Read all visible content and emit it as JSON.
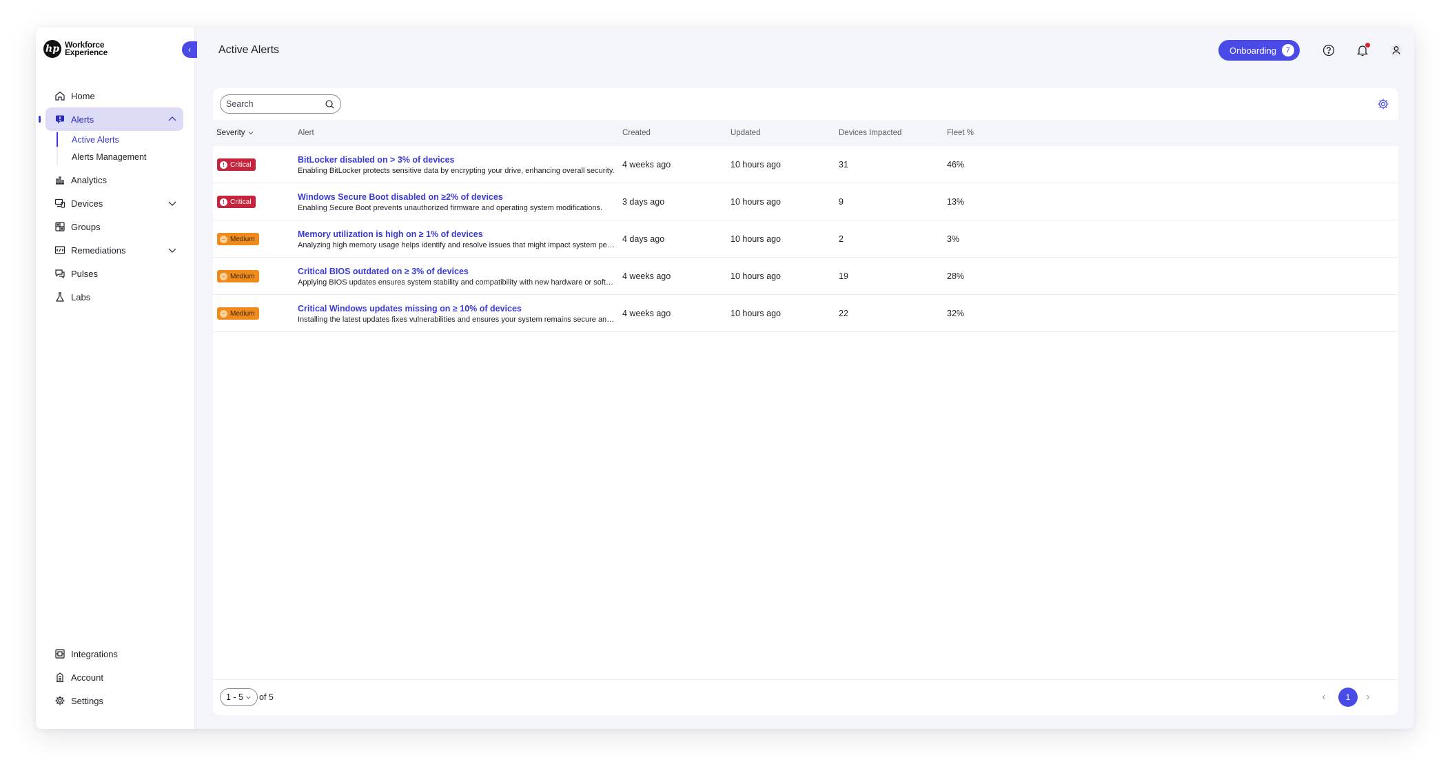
{
  "brand": {
    "logo_mark": "hp",
    "line1": "Workforce",
    "line2": "Experience"
  },
  "sidebar": {
    "items": [
      {
        "label": "Home",
        "icon": "home-icon"
      },
      {
        "label": "Alerts",
        "icon": "alert-icon"
      },
      {
        "label": "Analytics",
        "icon": "analytics-icon"
      },
      {
        "label": "Devices",
        "icon": "devices-icon"
      },
      {
        "label": "Groups",
        "icon": "groups-icon"
      },
      {
        "label": "Remediations",
        "icon": "remediations-icon"
      },
      {
        "label": "Pulses",
        "icon": "pulses-icon"
      },
      {
        "label": "Labs",
        "icon": "labs-icon"
      }
    ],
    "alerts_sub": [
      {
        "label": "Active Alerts"
      },
      {
        "label": "Alerts Management"
      }
    ],
    "bottom": [
      {
        "label": "Integrations",
        "icon": "integrations-icon"
      },
      {
        "label": "Account",
        "icon": "account-icon"
      },
      {
        "label": "Settings",
        "icon": "settings-icon"
      }
    ]
  },
  "header": {
    "title": "Active Alerts",
    "onboarding_label": "Onboarding",
    "onboarding_count": "7"
  },
  "search": {
    "placeholder": "Search"
  },
  "table": {
    "columns": {
      "severity": "Severity",
      "alert": "Alert",
      "created": "Created",
      "updated": "Updated",
      "devices": "Devices Impacted",
      "fleet": "Fleet %"
    },
    "rows": [
      {
        "severity": "Critical",
        "severity_glyph": "!",
        "title": "BitLocker disabled on > 3% of devices",
        "desc": "Enabling BitLocker protects sensitive data by encrypting your drive, enhancing overall security.",
        "created": "4 weeks ago",
        "updated": "10 hours ago",
        "devices": "31",
        "fleet": "46%"
      },
      {
        "severity": "Critical",
        "severity_glyph": "!",
        "title": "Windows Secure Boot disabled on ≥2% of devices",
        "desc": "Enabling Secure Boot prevents unauthorized firmware and operating system modifications.",
        "created": "3 days ago",
        "updated": "10 hours ago",
        "devices": "9",
        "fleet": "13%"
      },
      {
        "severity": "Medium",
        "severity_glyph": "−",
        "title": "Memory utilization is high on ≥ 1% of devices",
        "desc": "Analyzing high memory usage helps identify and resolve issues that might impact system performance.",
        "created": "4 days ago",
        "updated": "10 hours ago",
        "devices": "2",
        "fleet": "3%"
      },
      {
        "severity": "Medium",
        "severity_glyph": "−",
        "title": "Critical BIOS outdated on ≥ 3% of devices",
        "desc": "Applying BIOS updates ensures system stability and compatibility with new hardware or software.",
        "created": "4 weeks ago",
        "updated": "10 hours ago",
        "devices": "19",
        "fleet": "28%"
      },
      {
        "severity": "Medium",
        "severity_glyph": "−",
        "title": "Critical Windows updates missing on ≥ 10% of devices",
        "desc": "Installing the latest updates fixes vulnerabilities and ensures your system remains secure and stable.",
        "created": "4 weeks ago",
        "updated": "10 hours ago",
        "devices": "22",
        "fleet": "32%"
      }
    ]
  },
  "pagination": {
    "range": "1 - 5",
    "of_text": "of 5",
    "current_page": "1"
  },
  "colors": {
    "accent": "#4a4ae6",
    "critical": "#c4243e",
    "medium": "#f08a1a",
    "link": "#3a3ad6"
  }
}
